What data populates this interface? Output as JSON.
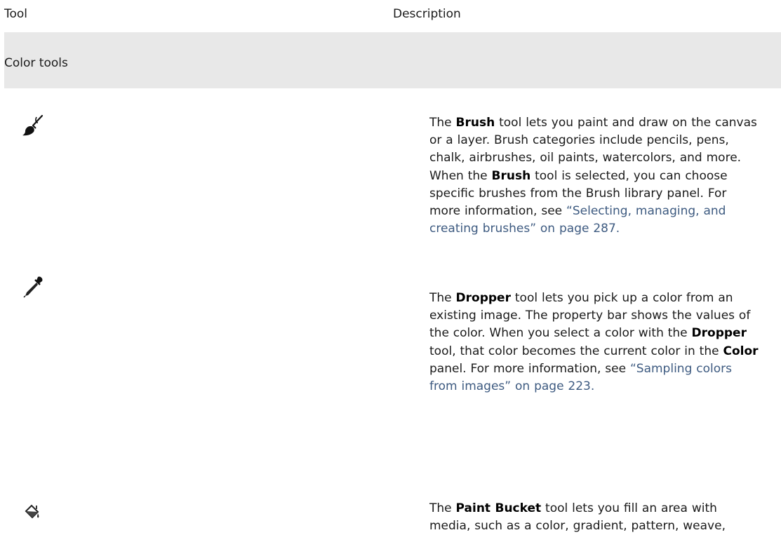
{
  "table": {
    "header": {
      "tool": "Tool",
      "description": "Description"
    },
    "section": {
      "label": "Color tools"
    },
    "rows": [
      {
        "icon": "brush-icon",
        "parts": {
          "p1": "The ",
          "b1": "Brush",
          "p2": " tool lets you paint and draw on the canvas or a layer. Brush categories include pencils, pens, chalk, airbrushes, oil paints, watercolors, and more. When the ",
          "b2": "Brush",
          "p3": " tool is selected, you can choose specific brushes from the Brush  library  panel. For more information, see ",
          "link": "“Selecting, managing, and creating brushes” on page 287."
        }
      },
      {
        "icon": "dropper-icon",
        "parts": {
          "p1": "The ",
          "b1": "Dropper",
          "p2": " tool lets you pick up a color from an existing image. The property bar shows the values of the color. When you select a color with the ",
          "b2": "Dropper",
          "p3": " tool, that color becomes the current color in the ",
          "b3": "Color",
          "p4": " panel. For more information, see ",
          "link": "“Sampling colors from images” on page 223."
        }
      },
      {
        "icon": "paint-bucket-icon",
        "parts": {
          "p1": "The ",
          "b1": "Paint Bucket",
          "p2": " tool lets you fill an area with media, such as a color, gradient, pattern, weave,"
        }
      }
    ]
  },
  "colors": {
    "section_bg": "#e8e8e8",
    "link": "#3d5a80"
  }
}
